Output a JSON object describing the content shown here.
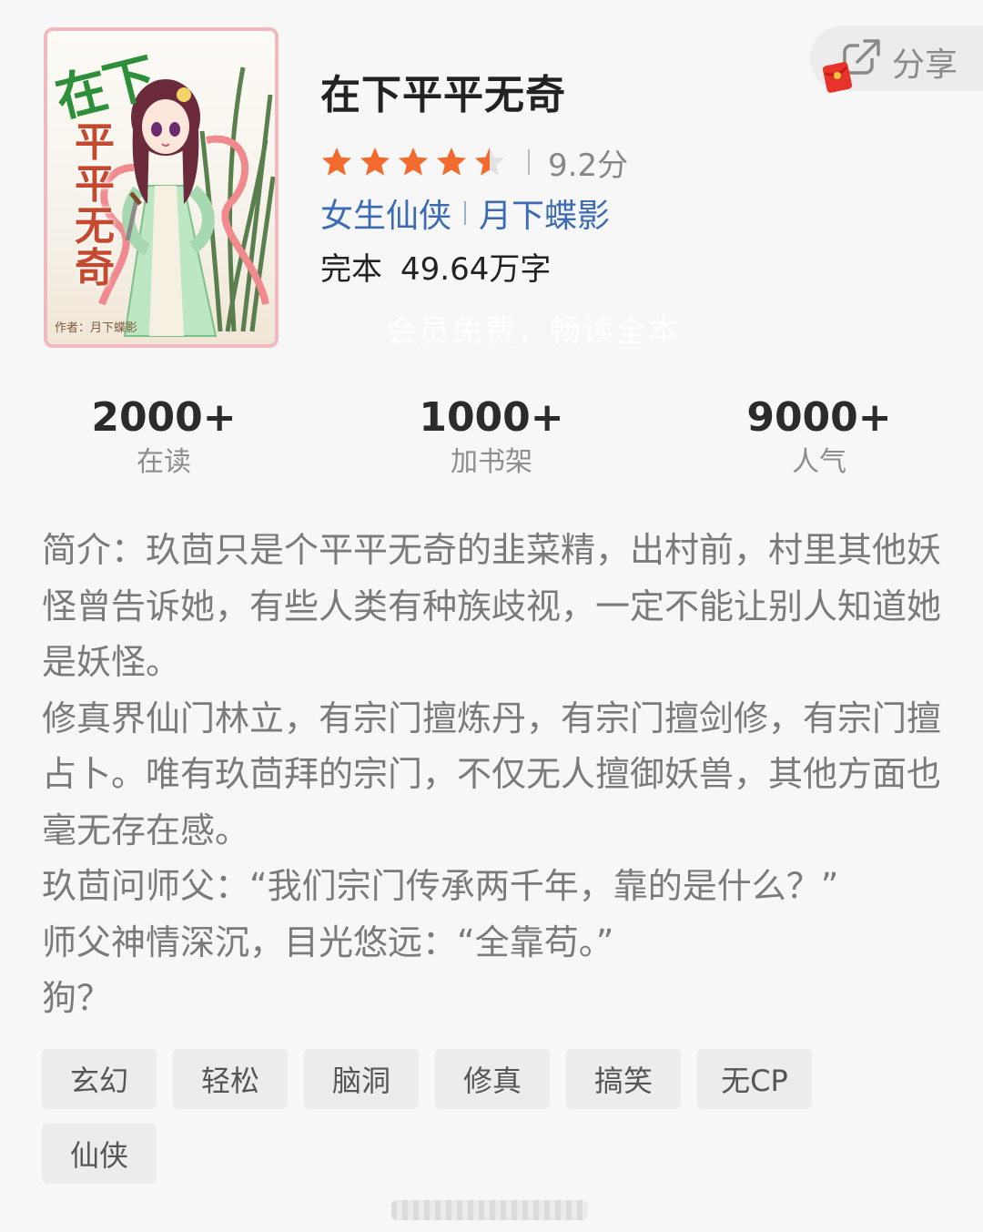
{
  "cover": {
    "title_top": "在下",
    "title_chars": [
      "平",
      "平",
      "无",
      "奇"
    ],
    "author": "作者：月下蝶影"
  },
  "book": {
    "title": "在下平平无奇",
    "rating": 4.5,
    "rating_max": 5,
    "score": "9.2分",
    "category": "女生仙侠",
    "author": "月下蝶影",
    "status": "完本",
    "word_count": "49.64万字",
    "promo_watermark": "会员免费，畅读全本"
  },
  "share": {
    "label": "分享",
    "icon": "share-icon",
    "badge_icon": "red-packet-icon"
  },
  "stats": [
    {
      "value": "2000+",
      "label": "在读"
    },
    {
      "value": "1000+",
      "label": "加书架"
    },
    {
      "value": "9000+",
      "label": "人气"
    }
  ],
  "intro": [
    "简介：玖茴只是个平平无奇的韭菜精，出村前，村里其他妖怪曾告诉她，有些人类有种族歧视，一定不能让别人知道她是妖怪。",
    "修真界仙门林立，有宗门擅炼丹，有宗门擅剑修，有宗门擅占卜。唯有玖茴拜的宗门，不仅无人擅御妖兽，其他方面也毫无存在感。",
    "玖茴问师父：“我们宗门传承两千年，靠的是什么？”",
    "师父神情深沉，目光悠远：“全靠苟。”",
    "狗？"
  ],
  "tags": [
    "玄幻",
    "轻松",
    "脑洞",
    "修真",
    "搞笑",
    "无CP",
    "仙侠"
  ],
  "colors": {
    "star": "#f26a2e",
    "link": "#3d6bb3",
    "background": "#f7f7f7",
    "tag_bg": "#ececec"
  }
}
